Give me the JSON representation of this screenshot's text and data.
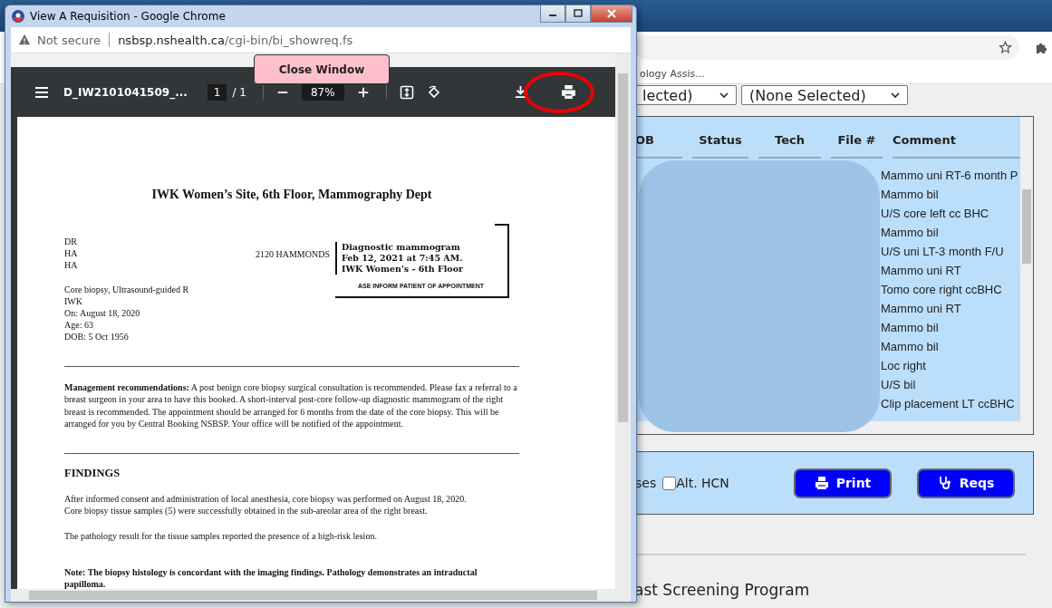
{
  "background": {
    "bookmark": "ology Assis...",
    "filters": [
      {
        "value": "lected)"
      },
      {
        "value": "(None Selected)"
      }
    ],
    "table": {
      "columns": [
        "OB",
        "Status",
        "Tech",
        "File #",
        "Comment"
      ],
      "comments": [
        "Mammo uni RT-6 month P",
        "Mammo bil",
        "U/S core left cc BHC",
        "Mammo bil",
        "U/S uni LT-3 month F/U",
        "Mammo uni RT",
        "Tomo core right ccBHC",
        "Mammo uni RT",
        "Mammo bil",
        "Mammo bil",
        "Loc right",
        "U/S bil",
        "Clip placement LT ccBHC"
      ]
    },
    "options_prefix": "ses",
    "alt_hcn": {
      "label": "Alt. HCN",
      "checked": false
    },
    "buttons": [
      {
        "label": "Print",
        "kind": "print"
      },
      {
        "label": "Reqs",
        "kind": "reqs"
      }
    ],
    "footer": "ast Screening Program"
  },
  "popup": {
    "title": "View A Requisition - Google Chrome",
    "security": "Not secure",
    "url_host": "nsbsp.nshealth.ca",
    "url_path": "/cgi-bin/bi_showreq.fs",
    "close_button": "Close Window",
    "pdf_toolbar": {
      "filename": "D_IW2101041509_...",
      "page": "1",
      "page_total": "/ 1",
      "zoom": "87%",
      "print_highlighted": true
    },
    "document": {
      "heading": "IWK Women’s Site, 6th Floor, Mammography Dept",
      "recipient_lines": [
        "DR",
        "HA",
        "HA"
      ],
      "address": "2120 HAMMONDS",
      "appointment": {
        "lines": [
          "Diagnostic mammogram",
          "Feb 12, 2021 at 7:45 AM.",
          "IWK Women's - 6th Floor"
        ],
        "notice": "ASE INFORM PATIENT OF APPOINTMENT"
      },
      "procedure_lines": [
        "Core biopsy, Ultrasound-guided R",
        "IWK",
        "On: August 18, 2020",
        "Age: 63",
        "DOB: 5 Oct 1956"
      ],
      "management": "**Management recommendations:** A post benign core biopsy surgical consultation is recommended.  Please fax a referral to a breast surgeon in your area to have this booked.  A short-interval post-core follow-up diagnostic mammogram of the right breast is recommended. The appointment should be arranged for 6 months from the date of the core biopsy.  This will be arranged for you by Central Booking NSBSP.  Your office will be notified of the appointment.",
      "findings_heading": "FINDINGS",
      "findings": [
        "After informed consent and administration of local anesthesia, core biopsy was performed on August 18, 2020.\nCore biopsy tissue samples (5) were successfully obtained in the sub-areolar area of the right breast.",
        "The pathology result for the tissue samples reported the presence of a high-risk lesion."
      ],
      "note": "Note: The biopsy histology is concordant with the imaging findings.  Pathology demonstrates an intraductal papilloma."
    }
  }
}
